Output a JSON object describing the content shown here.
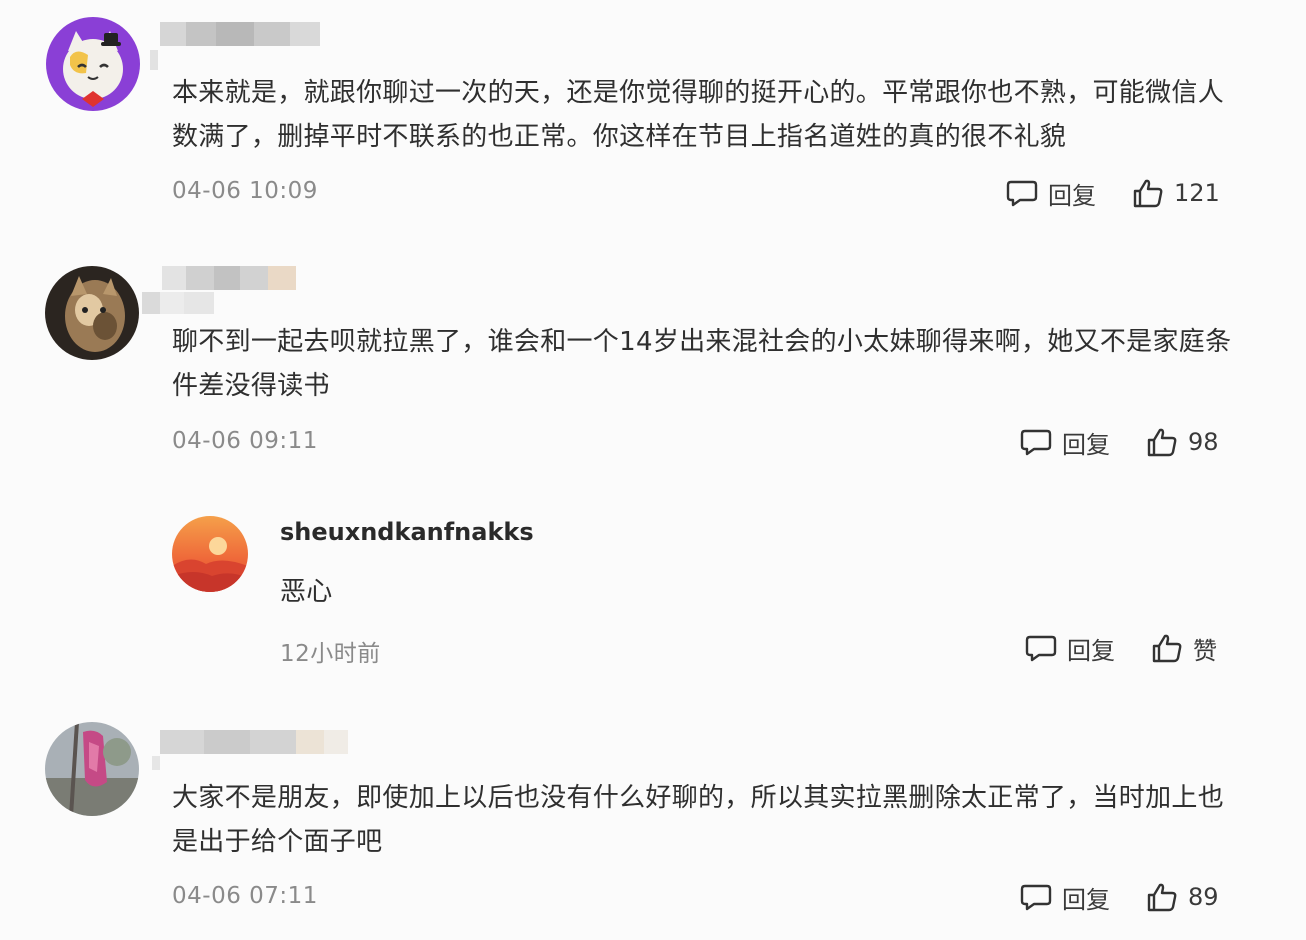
{
  "comments": [
    {
      "text": "本来就是，就跟你聊过一次的天，还是你觉得聊的挺开心的。平常跟你也不熟，可能微信人数满了，删掉平时不联系的也正常。你这样在节目上指名道姓的真的很不礼貌",
      "time": "04-06 10:09",
      "reply_label": "回复",
      "likes": "121"
    },
    {
      "text": "聊不到一起去呗就拉黑了，谁会和一个14岁出来混社会的小太妹聊得来啊，她又不是家庭条件差没得读书",
      "time": "04-06 09:11",
      "reply_label": "回复",
      "likes": "98"
    },
    {
      "text": "大家不是朋友，即使加上以后也没有什么好聊的，所以其实拉黑删除太正常了，当时加上也是出于给个面子吧",
      "time": "04-06 07:11",
      "reply_label": "回复",
      "likes": "89"
    }
  ],
  "reply": {
    "username": "sheuxndkanfnakks",
    "text": "恶心",
    "time": "12小时前",
    "reply_label": "回复",
    "like_label": "赞"
  },
  "icons": {
    "reply": "comment-bubble-icon",
    "like": "thumbs-up-icon"
  },
  "colors": {
    "background": "#fbfbfb",
    "text": "#2f2f2f",
    "muted": "#8a8a8a"
  }
}
